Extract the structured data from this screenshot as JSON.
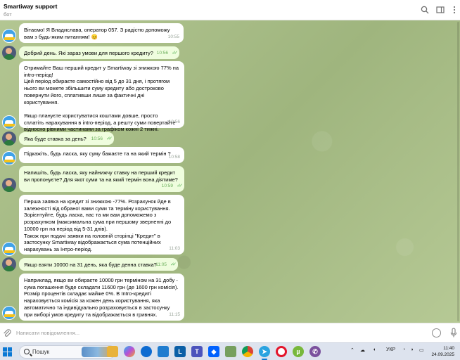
{
  "header": {
    "title": "Smartiway support",
    "subtitle": "бот",
    "icons": [
      "search-icon",
      "sidebar-panel-icon",
      "more-vertical-icon"
    ]
  },
  "messages": [
    {
      "from": "bot",
      "text": "Вітаємо! Я Владислава, оператор 057. З радістю допоможу вам з будь-яким питанням! 😊",
      "time": "10:55"
    },
    {
      "from": "user",
      "text": "Добрий день. Які зараз умови для першого кредиту?",
      "time": "10:56",
      "read": true
    },
    {
      "from": "bot",
      "text": "Отримайте Ваш перший кредит у Smartiway зі знижкою 77% на intro-період!\nЦей період обираєте самостійно від 5 до 31 дня, і протягом нього ви можете збільшити суму кредиту або достроково повернути його, сплативши лише за фактичні дні користування.\n\nЯкщо плануєте користуватися коштами довше, просто сплатіть нарахування в intro-період, а решту суми повертайте відносно рівними частинами за графіком кожні 2 тижні.",
      "time": "10:56"
    },
    {
      "from": "user",
      "text": "Яка буде ставка за день?",
      "time": "10:56",
      "read": true
    },
    {
      "from": "bot",
      "text": "Підкажіть, будь ласка, яку суму бажаєте та на який термін ?",
      "time": "10:58"
    },
    {
      "from": "user",
      "text": "Напишіть, будь ласка, яку найнижчу ставку на перший кредит ви пропонуєте? Для якої суми та на який термін вона діятиме?",
      "time": "10:59",
      "read": true
    },
    {
      "from": "bot",
      "text": "Перша заявка на кредит зі знижкою -77%. Розрахунок йде в залежності від обраної вами суми та терміну користування.\nЗорієнтуйте, будь ласка, нас та ми вам допоможемо з розрахунком (максимальна сума при першому зверненні до 10000 грн на період від 5-31 днів).\nТакож при подачі заявки на головній сторінці \"Кредит\" в застосунку Smartiway відображається сума потенційних нарахувань за Інтро-період.",
      "time": "11:03"
    },
    {
      "from": "user",
      "text": "Якщо взяти 10000 на 31 день, яка буде денна ставка?",
      "time": "11:05",
      "read": true
    },
    {
      "from": "bot",
      "text": "Наприклад, якщо ви обираєте 10000 грн терміном на 31 добу - сума погашення буде складати 11600 грн (де 1600 грн комісія).\nРозмір процентів складає майже 0%. В Intro-кредиті нараховується комісія за кожен день користування, яка автоматично та індивідуально розраховується в застосунку при виборі умов кредиту та відображається в гривнях.",
      "time": "11:15"
    }
  ],
  "input": {
    "placeholder": "Написати повідомлення..."
  },
  "taskbar": {
    "search_label": "Пошук",
    "apps": [
      "windows-start-icon",
      "file-explorer-icon",
      "copilot-icon",
      "edge-icon",
      "microsoft-store-icon",
      "libreoffice-icon",
      "teams-icon",
      "dropbox-icon",
      "chrome-icon",
      "telegram-icon",
      "opera-icon",
      "utorrent-icon",
      "viber-icon"
    ],
    "lang": "УКР",
    "time": "11:40",
    "date": "24.09.2025",
    "colors": {
      "accent": "#0a78d4"
    }
  }
}
